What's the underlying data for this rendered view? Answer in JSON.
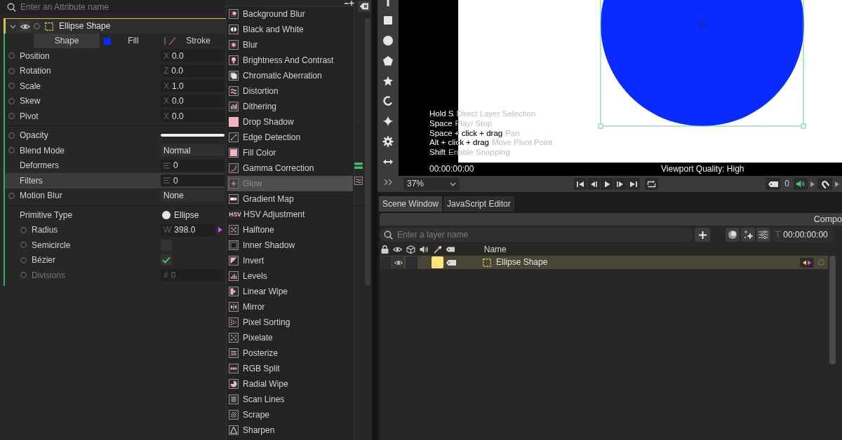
{
  "attribute_search": {
    "placeholder": "Enter an Attribute name"
  },
  "layer_header": {
    "title": "Ellipse Shape",
    "expanded": true,
    "visible": true
  },
  "attribute_tabs": [
    {
      "label": "Shape",
      "kind": "plain",
      "selected": true
    },
    {
      "label": "Fill",
      "kind": "fill",
      "color": "#0a2bff",
      "selected": false
    },
    {
      "label": "Stroke",
      "kind": "stroke",
      "selected": false
    }
  ],
  "attribute_groups": [
    {
      "rows": [
        {
          "label": "Position",
          "kind": "vector",
          "axis": "X",
          "value": "0.0",
          "connected": false,
          "keyframe_button": true,
          "selected": false,
          "disabled": false
        },
        {
          "label": "Rotation",
          "kind": "vector",
          "axis": "Z",
          "value": "0.0",
          "connected": false,
          "keyframe_button": true,
          "selected": false,
          "disabled": false
        },
        {
          "label": "Scale",
          "kind": "vector",
          "axis": "X",
          "value": "1.0",
          "connected": false,
          "keyframe_button": true,
          "selected": false,
          "disabled": false
        },
        {
          "label": "Skew",
          "kind": "vector",
          "axis": "X",
          "value": "0.0",
          "connected": false,
          "keyframe_button": true,
          "selected": false,
          "disabled": false
        },
        {
          "label": "Pivot",
          "kind": "vector",
          "axis": "X",
          "value": "0.0",
          "connected": false,
          "keyframe_button": true,
          "selected": false,
          "disabled": false
        }
      ]
    },
    {
      "rows": [
        {
          "label": "Opacity",
          "kind": "slider",
          "level": 1,
          "keyframe_button": true,
          "selected": false,
          "disabled": false
        },
        {
          "label": "Blend Mode",
          "kind": "dropdown",
          "value": "Normal",
          "keyframe_button": true,
          "selected": false,
          "disabled": false
        },
        {
          "label": "Deformers",
          "kind": "list",
          "value": "0",
          "keyframe_button": false,
          "selected": false,
          "disabled": false
        },
        {
          "label": "Filters",
          "kind": "list",
          "value": "0",
          "keyframe_button": false,
          "selected": true,
          "disabled": false
        },
        {
          "label": "Motion Blur",
          "kind": "dropdown",
          "value": "None",
          "keyframe_button": true,
          "selected": false,
          "disabled": false
        }
      ]
    },
    {
      "rows": [
        {
          "label": "Primitive Type",
          "kind": "shape",
          "value": "Ellipse",
          "keyframe_button": false,
          "selected": false,
          "disabled": false,
          "children": [
            {
              "label": "Radius",
              "kind": "vector",
              "axis": "W",
              "value": "398.0",
              "connected": true,
              "keyframe_button": true,
              "selected": false,
              "disabled": false
            },
            {
              "label": "Semicircle",
              "kind": "checkbox",
              "checked": false,
              "keyframe_button": true,
              "selected": false,
              "disabled": false
            },
            {
              "label": "Bézier",
              "kind": "checkbox",
              "checked": true,
              "keyframe_button": true,
              "selected": false,
              "disabled": false
            },
            {
              "label": "Divisions",
              "kind": "vector",
              "axis": "#",
              "value": "0",
              "connected": false,
              "keyframe_button": true,
              "selected": false,
              "disabled": true
            }
          ]
        }
      ]
    }
  ],
  "filter_menu": {
    "items": [
      {
        "label": "Background Blur",
        "selected": false,
        "disabled": false
      },
      {
        "label": "Black and White",
        "selected": false,
        "disabled": false
      },
      {
        "label": "Blur",
        "selected": false,
        "disabled": false
      },
      {
        "label": "Brightness And Contrast",
        "selected": false,
        "disabled": false
      },
      {
        "label": "Chromatic Aberration",
        "selected": false,
        "disabled": false
      },
      {
        "label": "Distortion",
        "selected": false,
        "disabled": false
      },
      {
        "label": "Dithering",
        "selected": false,
        "disabled": false
      },
      {
        "label": "Drop Shadow",
        "selected": false,
        "disabled": false
      },
      {
        "label": "Edge Detection",
        "selected": false,
        "disabled": false
      },
      {
        "label": "Fill Color",
        "selected": false,
        "disabled": false
      },
      {
        "label": "Gamma Correction",
        "selected": false,
        "disabled": false
      },
      {
        "label": "Glow",
        "selected": true,
        "disabled": true
      },
      {
        "label": "Gradient Map",
        "selected": false,
        "disabled": false
      },
      {
        "label": "HSV Adjustment",
        "icon_text": "HSV",
        "selected": false,
        "disabled": false
      },
      {
        "label": "Halftone",
        "selected": false,
        "disabled": false
      },
      {
        "label": "Inner Shadow",
        "selected": false,
        "disabled": false
      },
      {
        "label": "Invert",
        "selected": false,
        "disabled": false
      },
      {
        "label": "Levels",
        "selected": false,
        "disabled": false
      },
      {
        "label": "Linear Wipe",
        "selected": false,
        "disabled": false
      },
      {
        "label": "Mirror",
        "selected": false,
        "disabled": false
      },
      {
        "label": "Pixel Sorting",
        "selected": false,
        "disabled": false
      },
      {
        "label": "Pixelate",
        "selected": false,
        "disabled": false
      },
      {
        "label": "Posterize",
        "selected": false,
        "disabled": false
      },
      {
        "label": "RGB Split",
        "selected": false,
        "disabled": false
      },
      {
        "label": "Radial Wipe",
        "selected": false,
        "disabled": false
      },
      {
        "label": "Scan Lines",
        "selected": false,
        "disabled": false
      },
      {
        "label": "Scrape",
        "selected": false,
        "disabled": false
      },
      {
        "label": "Sharpen",
        "selected": false,
        "disabled": false
      }
    ]
  },
  "viewport": {
    "shortcuts": [
      {
        "keys": "Hold S",
        "action": "Direct Layer Selection"
      },
      {
        "keys": "Space",
        "action": "Play/ Stop"
      },
      {
        "keys": "Space + click + drag",
        "action": "Pan"
      },
      {
        "keys": "Alt + click + drag",
        "action": "Move Pivot Point"
      },
      {
        "keys": "Shift",
        "action": "Enable Snapping"
      }
    ],
    "timecode": "00:00:00:00",
    "quality": "Viewport Quality: High"
  },
  "playback": {
    "zoom": "37%",
    "marker_count": "0"
  },
  "panel_tabs": [
    {
      "label": "Scene Window",
      "selected": true
    },
    {
      "label": "JavaScript Editor",
      "selected": false
    }
  ],
  "scene": {
    "title": "Compo",
    "search": {
      "placeholder": "Enter a layer name"
    },
    "time_prefix": "T",
    "time": "00:00:00:00",
    "columns": [
      "Name"
    ],
    "layers": [
      {
        "name": "Ellipse Shape",
        "color": "#fde27a",
        "visible": true,
        "selected": true
      }
    ]
  }
}
